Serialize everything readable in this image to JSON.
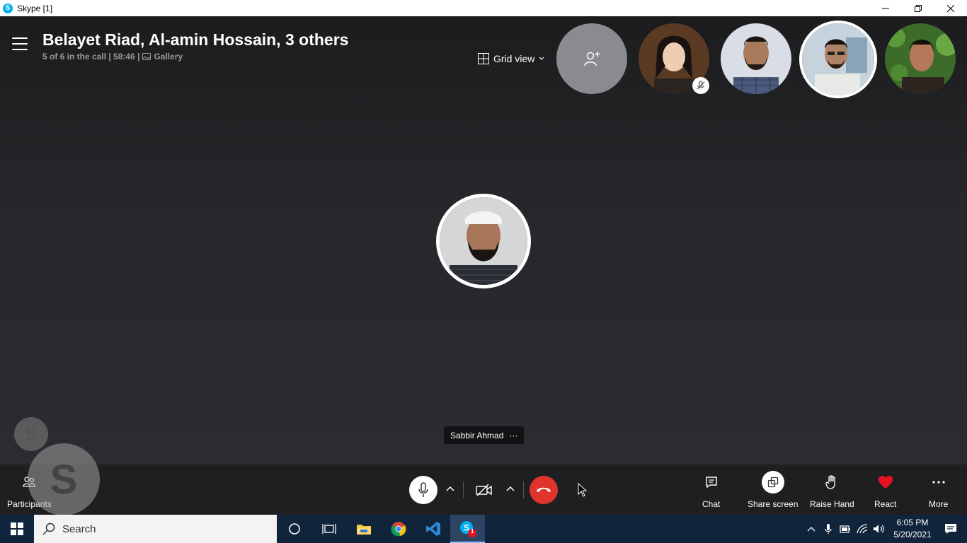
{
  "window": {
    "title": "Skype [1]"
  },
  "call": {
    "title": "Belayet Riad, Al-amin Hossain, 3 others",
    "status": "5 of 6 in the call | 58:46 |",
    "gallery_label": "Gallery",
    "view_label": "Grid view",
    "speaker_name": "Sabbir Ahmad",
    "more_dots": "···"
  },
  "controls": {
    "participants": "Participants",
    "chat": "Chat",
    "share_screen": "Share screen",
    "raise_hand": "Raise Hand",
    "react": "React",
    "more": "More"
  },
  "taskbar": {
    "search_placeholder": "Search",
    "time": "6:05 PM",
    "date": "5/20/2021",
    "skype_badge": "1"
  },
  "colors": {
    "end_call": "#e0332c",
    "react_heart": "#e81123",
    "taskbar": "#10243b"
  }
}
